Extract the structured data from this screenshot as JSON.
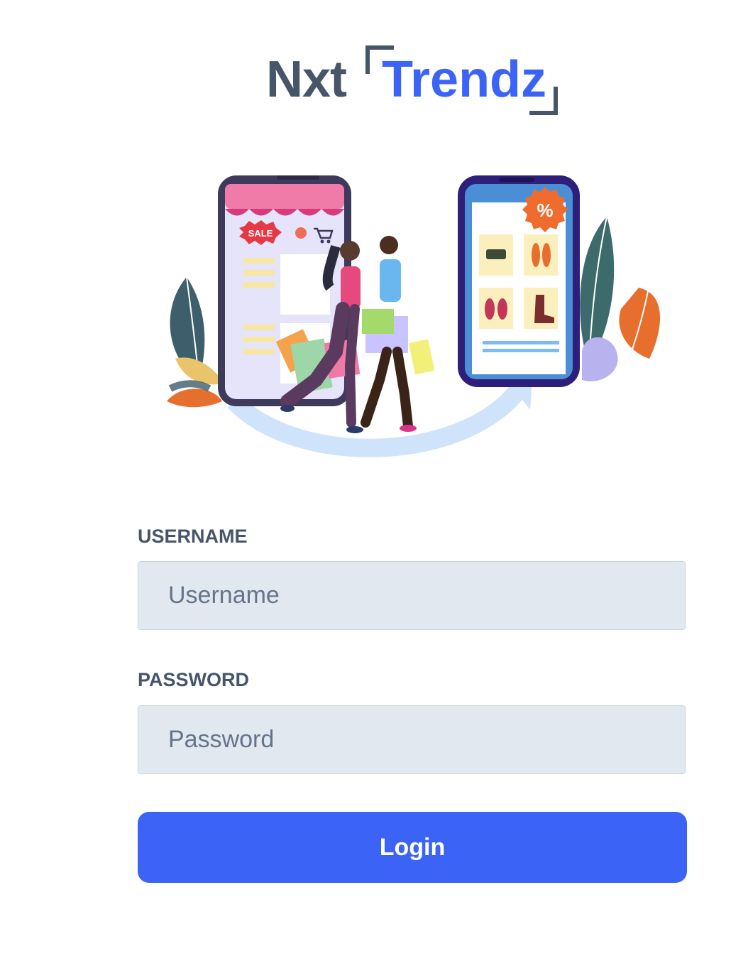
{
  "brand": {
    "part1": "Nxt",
    "part2": "Trendz"
  },
  "illustration": {
    "sale_badge": "SALE",
    "discount_badge": "%"
  },
  "form": {
    "username": {
      "label": "USERNAME",
      "placeholder": "Username",
      "value": ""
    },
    "password": {
      "label": "PASSWORD",
      "placeholder": "Password",
      "value": ""
    },
    "login_label": "Login"
  },
  "colors": {
    "brand_primary": "#3b64f6",
    "brand_dark": "#475569",
    "input_bg": "#e2e8f0"
  }
}
